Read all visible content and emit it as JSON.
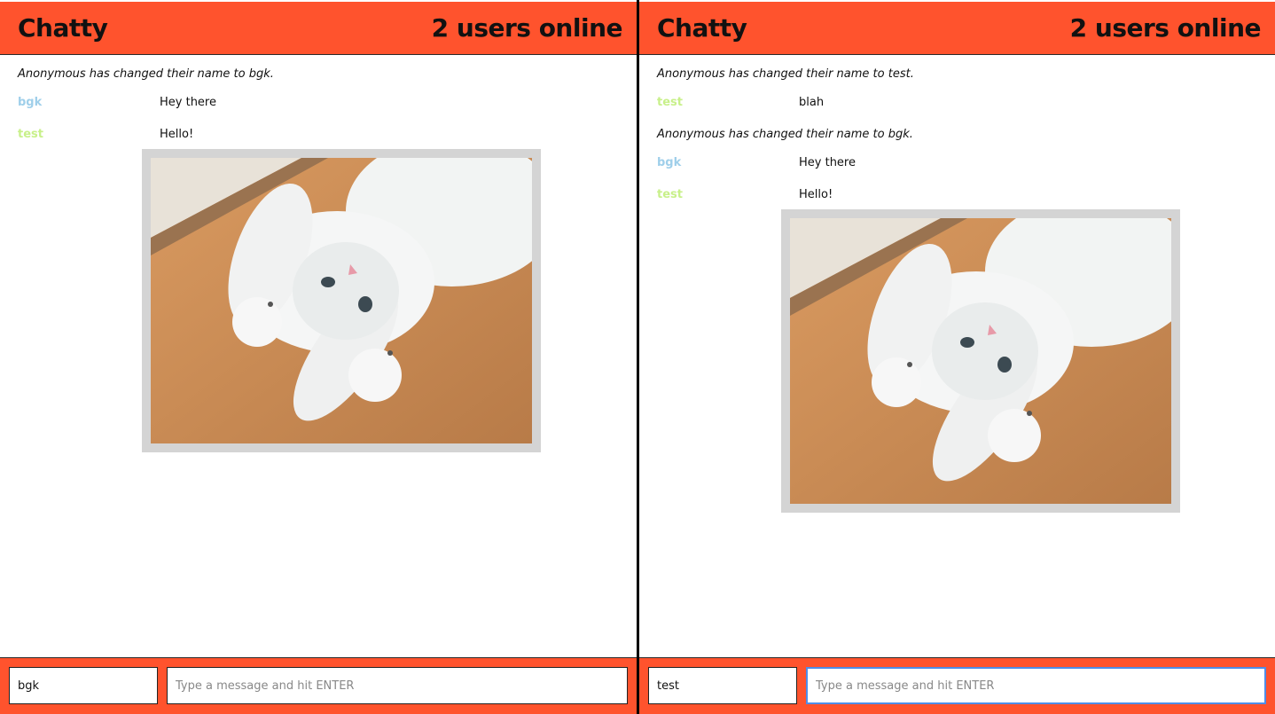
{
  "left": {
    "header": {
      "brand": "Chatty",
      "online": "2 users online"
    },
    "messages": [
      {
        "type": "system",
        "text": "Anonymous has changed their name to bgk."
      },
      {
        "type": "chat",
        "user": "bgk",
        "text": "Hey there"
      },
      {
        "type": "chat",
        "user": "test",
        "text": "Hello!"
      }
    ],
    "footer": {
      "name_value": "bgk",
      "message_placeholder": "Type a message and hit ENTER"
    }
  },
  "right": {
    "header": {
      "brand": "Chatty",
      "online": "2 users online"
    },
    "messages": [
      {
        "type": "system",
        "text": "Anonymous has changed their name to test."
      },
      {
        "type": "chat",
        "user": "test",
        "text": "blah"
      },
      {
        "type": "system",
        "text": "Anonymous has changed their name to bgk."
      },
      {
        "type": "chat",
        "user": "bgk",
        "text": "Hey there"
      },
      {
        "type": "chat",
        "user": "test",
        "text": "Hello!"
      }
    ],
    "footer": {
      "name_value": "test",
      "message_placeholder": "Type a message and hit ENTER"
    }
  },
  "colors": {
    "brand_bar": "#ff532d",
    "user_bgk": "#9fcfea",
    "user_test": "#c8f08a",
    "focus_ring": "#4f8de8"
  }
}
